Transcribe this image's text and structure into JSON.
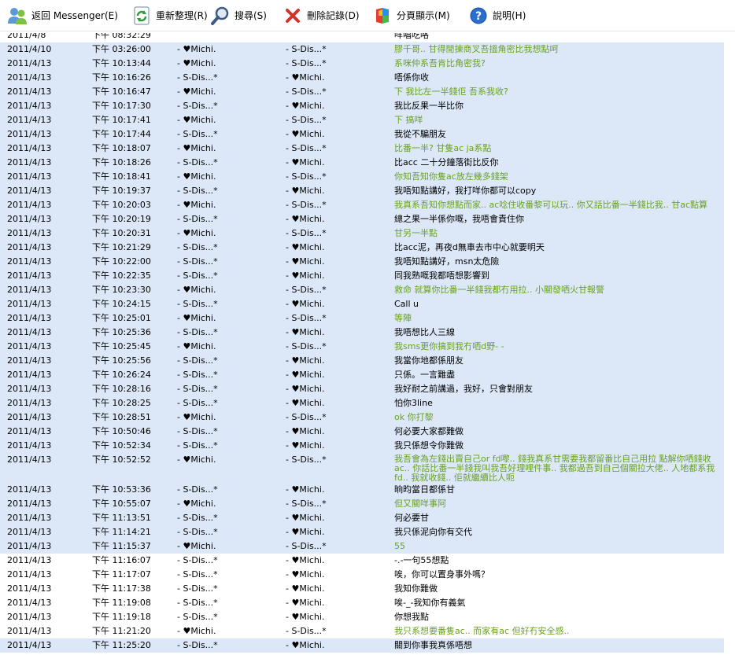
{
  "toolbar": {
    "back_label": "返回 Messenger(E)",
    "refresh_label": "重新整理(R)",
    "search_label": "搜尋(S)",
    "delete_label": "刪除記錄(D)",
    "paging_label": "分頁顯示(M)",
    "help_label": "說明(H)"
  },
  "colors": {
    "selection": "#dce8f8",
    "green_text": "#6aa121"
  },
  "rows": [
    {
      "date": "2011/4/8",
      "time": "下午 08:32:29",
      "from": "",
      "to": "",
      "msg": "咩唱吃咯",
      "green": false,
      "sel": false
    },
    {
      "date": "2011/4/10",
      "time": "下午 03:26:00",
      "from": "- ♥Michi.",
      "to": "- S-Dis...*",
      "msg": "膠千哥.. 甘得閒揀商叉吾搵角密比我想點呵",
      "green": true,
      "sel": true
    },
    {
      "date": "2011/4/13",
      "time": "下午 10:13:44",
      "from": "- ♥Michi.",
      "to": "- S-Dis...*",
      "msg": "系咪仲系吾肯比角密我?",
      "green": true,
      "sel": true
    },
    {
      "date": "2011/4/13",
      "time": "下午 10:16:26",
      "from": "- S-Dis...*",
      "to": "- ♥Michi.",
      "msg": "唔係你收",
      "green": false,
      "sel": true
    },
    {
      "date": "2011/4/13",
      "time": "下午 10:16:47",
      "from": "- ♥Michi.",
      "to": "- S-Dis...*",
      "msg": "下 我比左一半錢佢 吾系我收?",
      "green": true,
      "sel": true
    },
    {
      "date": "2011/4/13",
      "time": "下午 10:17:30",
      "from": "- S-Dis...*",
      "to": "- ♥Michi.",
      "msg": "我比反果一半比你",
      "green": false,
      "sel": true
    },
    {
      "date": "2011/4/13",
      "time": "下午 10:17:41",
      "from": "- ♥Michi.",
      "to": "- S-Dis...*",
      "msg": "下 搞咩",
      "green": true,
      "sel": true
    },
    {
      "date": "2011/4/13",
      "time": "下午 10:17:44",
      "from": "- S-Dis...*",
      "to": "- ♥Michi.",
      "msg": "我從不騙朋友",
      "green": false,
      "sel": true
    },
    {
      "date": "2011/4/13",
      "time": "下午 10:18:07",
      "from": "- ♥Michi.",
      "to": "- S-Dis...*",
      "msg": "比番一半? 甘隻ac ja系點",
      "green": true,
      "sel": true
    },
    {
      "date": "2011/4/13",
      "time": "下午 10:18:26",
      "from": "- S-Dis...*",
      "to": "- ♥Michi.",
      "msg": "比acc 二十分鐘落街比反你",
      "green": false,
      "sel": true
    },
    {
      "date": "2011/4/13",
      "time": "下午 10:18:41",
      "from": "- ♥Michi.",
      "to": "- S-Dis...*",
      "msg": "你知吾知你隻ac放左幾多錢架",
      "green": true,
      "sel": true
    },
    {
      "date": "2011/4/13",
      "time": "下午 10:19:37",
      "from": "- S-Dis...*",
      "to": "- ♥Michi.",
      "msg": "我唔知點講好，我打咩你都可以copy",
      "green": false,
      "sel": true
    },
    {
      "date": "2011/4/13",
      "time": "下午 10:20:03",
      "from": "- ♥Michi.",
      "to": "- S-Dis...*",
      "msg": "我真系吾知你想點而家.. ac唸住收番黎可以玩.. 你又話比番一半錢比我.. 甘ac點算",
      "green": true,
      "sel": true
    },
    {
      "date": "2011/4/13",
      "time": "下午 10:20:19",
      "from": "- S-Dis...*",
      "to": "- ♥Michi.",
      "msg": "總之果一半係你嘅，我唔會責住你",
      "green": false,
      "sel": true
    },
    {
      "date": "2011/4/13",
      "time": "下午 10:20:31",
      "from": "- ♥Michi.",
      "to": "- S-Dis...*",
      "msg": "甘另一半點",
      "green": true,
      "sel": true
    },
    {
      "date": "2011/4/13",
      "time": "下午 10:21:29",
      "from": "- S-Dis...*",
      "to": "- ♥Michi.",
      "msg": "比acc泥，再夜d無車去市中心就要明天",
      "green": false,
      "sel": true
    },
    {
      "date": "2011/4/13",
      "time": "下午 10:22:00",
      "from": "- S-Dis...*",
      "to": "- ♥Michi.",
      "msg": "我唔知點講好，msn太危險",
      "green": false,
      "sel": true
    },
    {
      "date": "2011/4/13",
      "time": "下午 10:22:35",
      "from": "- S-Dis...*",
      "to": "- ♥Michi.",
      "msg": "同我熟嘅我都唔想影響到",
      "green": false,
      "sel": true
    },
    {
      "date": "2011/4/13",
      "time": "下午 10:23:30",
      "from": "- ♥Michi.",
      "to": "- S-Dis...*",
      "msg": "救命 就算你比番一半錢我都冇用拉.. 小關發哂火甘報警",
      "green": true,
      "sel": true
    },
    {
      "date": "2011/4/13",
      "time": "下午 10:24:15",
      "from": "- S-Dis...*",
      "to": "- ♥Michi.",
      "msg": "Call u",
      "green": false,
      "sel": true
    },
    {
      "date": "2011/4/13",
      "time": "下午 10:25:01",
      "from": "- ♥Michi.",
      "to": "- S-Dis...*",
      "msg": "等陣",
      "green": true,
      "sel": true
    },
    {
      "date": "2011/4/13",
      "time": "下午 10:25:36",
      "from": "- S-Dis...*",
      "to": "- ♥Michi.",
      "msg": "我唔想比人三線",
      "green": false,
      "sel": true
    },
    {
      "date": "2011/4/13",
      "time": "下午 10:25:45",
      "from": "- ♥Michi.",
      "to": "- S-Dis...*",
      "msg": "我sms更你搞到我冇哂d野- -",
      "green": true,
      "sel": true
    },
    {
      "date": "2011/4/13",
      "time": "下午 10:25:56",
      "from": "- S-Dis...*",
      "to": "- ♥Michi.",
      "msg": "我當你地都係朋友",
      "green": false,
      "sel": true
    },
    {
      "date": "2011/4/13",
      "time": "下午 10:26:24",
      "from": "- S-Dis...*",
      "to": "- ♥Michi.",
      "msg": "只係。一言難盡",
      "green": false,
      "sel": true
    },
    {
      "date": "2011/4/13",
      "time": "下午 10:28:16",
      "from": "- S-Dis...*",
      "to": "- ♥Michi.",
      "msg": "我好耐之前講過，我好，只會對朋友",
      "green": false,
      "sel": true
    },
    {
      "date": "2011/4/13",
      "time": "下午 10:28:25",
      "from": "- S-Dis...*",
      "to": "- ♥Michi.",
      "msg": "怕你3line",
      "green": false,
      "sel": true
    },
    {
      "date": "2011/4/13",
      "time": "下午 10:28:51",
      "from": "- ♥Michi.",
      "to": "- S-Dis...*",
      "msg": "ok 你打黎",
      "green": true,
      "sel": true
    },
    {
      "date": "2011/4/13",
      "time": "下午 10:50:46",
      "from": "- S-Dis...*",
      "to": "- ♥Michi.",
      "msg": "何必要大家都難做",
      "green": false,
      "sel": true
    },
    {
      "date": "2011/4/13",
      "time": "下午 10:52:34",
      "from": "- S-Dis...*",
      "to": "- ♥Michi.",
      "msg": "我只係想令你難做",
      "green": false,
      "sel": true
    },
    {
      "date": "2011/4/13",
      "time": "下午 10:52:52",
      "from": "- ♥Michi.",
      "to": "- S-Dis...*",
      "msg": "我吾會為左錢出賣自己or fd嚟.. 錢我真系甘需要我都留番比自己用拉 點解你哂錢收ac.. 你話比番一半錢我叫我吾好理哩件事.. 我都過吾到自己個關拉大佬.. 人地都系我fd.. 我就收錢.. 佢就繼續比人呃",
      "green": true,
      "sel": true,
      "multi": true
    },
    {
      "date": "2011/4/13",
      "time": "下午 10:53:36",
      "from": "- S-Dis...*",
      "to": "- ♥Michi.",
      "msg": "晌昀當日都係甘",
      "green": false,
      "sel": true
    },
    {
      "date": "2011/4/13",
      "time": "下午 10:55:07",
      "from": "- ♥Michi.",
      "to": "- S-Dis...*",
      "msg": "但又關咩事阿",
      "green": true,
      "sel": true
    },
    {
      "date": "2011/4/13",
      "time": "下午 11:13:51",
      "from": "- S-Dis...*",
      "to": "- ♥Michi.",
      "msg": "何必要甘",
      "green": false,
      "sel": true
    },
    {
      "date": "2011/4/13",
      "time": "下午 11:14:21",
      "from": "- S-Dis...*",
      "to": "- ♥Michi.",
      "msg": "我只係泥向你有交代",
      "green": false,
      "sel": true
    },
    {
      "date": "2011/4/13",
      "time": "下午 11:15:37",
      "from": "- ♥Michi.",
      "to": "- S-Dis...*",
      "msg": "55",
      "green": true,
      "sel": true
    },
    {
      "date": "2011/4/13",
      "time": "下午 11:16:07",
      "from": "- S-Dis...*",
      "to": "- ♥Michi.",
      "msg": "-.-一句55想點",
      "green": false,
      "sel": false
    },
    {
      "date": "2011/4/13",
      "time": "下午 11:17:07",
      "from": "- S-Dis...*",
      "to": "- ♥Michi.",
      "msg": "唉，你可以置身事外嗎？",
      "green": false,
      "sel": false
    },
    {
      "date": "2011/4/13",
      "time": "下午 11:17:38",
      "from": "- S-Dis...*",
      "to": "- ♥Michi.",
      "msg": "我知你難做",
      "green": false,
      "sel": false
    },
    {
      "date": "2011/4/13",
      "time": "下午 11:19:08",
      "from": "- S-Dis...*",
      "to": "- ♥Michi.",
      "msg": "唉-_-我知你有義氣",
      "green": false,
      "sel": false
    },
    {
      "date": "2011/4/13",
      "time": "下午 11:19:18",
      "from": "- S-Dis...*",
      "to": "- ♥Michi.",
      "msg": "你想我點",
      "green": false,
      "sel": false
    },
    {
      "date": "2011/4/13",
      "time": "下午 11:21:20",
      "from": "- ♥Michi.",
      "to": "- S-Dis...*",
      "msg": "我只系想要番隻ac.. 而家有ac 但好冇安全感..",
      "green": true,
      "sel": false
    },
    {
      "date": "2011/4/13",
      "time": "下午 11:25:20",
      "from": "- S-Dis...*",
      "to": "- ♥Michi.",
      "msg": "關到你事我真係唔想",
      "green": false,
      "sel": true
    }
  ]
}
